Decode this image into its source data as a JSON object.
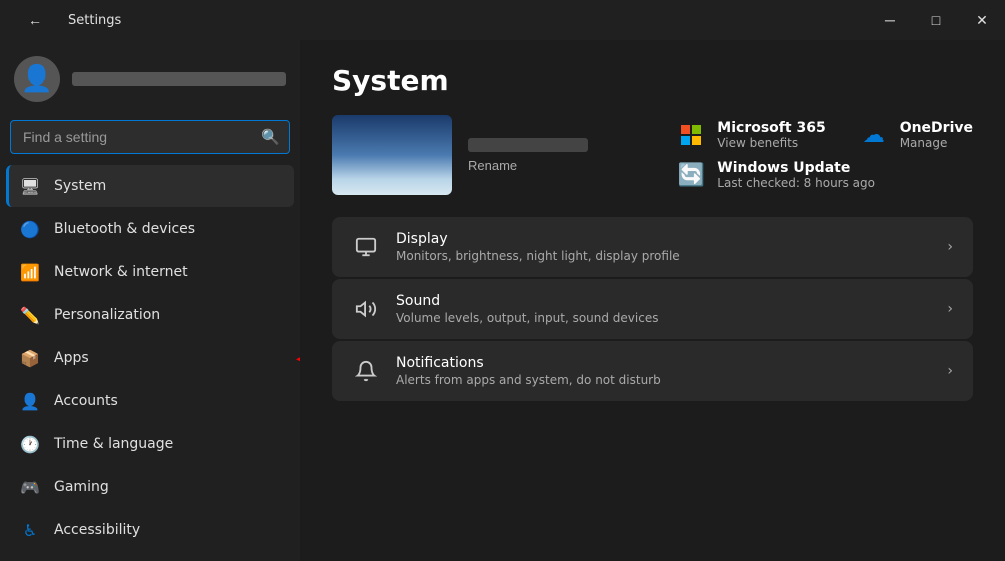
{
  "titlebar": {
    "back_icon": "←",
    "title": "Settings",
    "minimize_label": "─",
    "restore_label": "□",
    "close_label": "✕"
  },
  "sidebar": {
    "search_placeholder": "Find a setting",
    "search_icon": "🔍",
    "nav_items": [
      {
        "id": "system",
        "label": "System",
        "icon": "🖥",
        "active": true
      },
      {
        "id": "bluetooth",
        "label": "Bluetooth & devices",
        "icon": "🔵",
        "active": false
      },
      {
        "id": "network",
        "label": "Network & internet",
        "icon": "📶",
        "active": false
      },
      {
        "id": "personalization",
        "label": "Personalization",
        "icon": "✏️",
        "active": false
      },
      {
        "id": "apps",
        "label": "Apps",
        "icon": "📦",
        "active": false
      },
      {
        "id": "accounts",
        "label": "Accounts",
        "icon": "👤",
        "active": false
      },
      {
        "id": "time",
        "label": "Time & language",
        "icon": "🕐",
        "active": false
      },
      {
        "id": "gaming",
        "label": "Gaming",
        "icon": "🎮",
        "active": false
      },
      {
        "id": "accessibility",
        "label": "Accessibility",
        "icon": "♿",
        "active": false
      }
    ]
  },
  "content": {
    "page_title": "System",
    "pc_rename_label": "Rename",
    "info_cards": [
      {
        "id": "microsoft365",
        "icon": "⊞",
        "title": "Microsoft 365",
        "subtitle": "View benefits"
      },
      {
        "id": "onedrive",
        "icon": "☁",
        "title": "OneDrive",
        "subtitle": "Manage"
      },
      {
        "id": "windowsupdate",
        "icon": "🔄",
        "title": "Windows Update",
        "subtitle": "Last checked: 8 hours ago"
      }
    ],
    "settings_items": [
      {
        "id": "display",
        "icon": "🖥",
        "title": "Display",
        "description": "Monitors, brightness, night light, display profile"
      },
      {
        "id": "sound",
        "icon": "🔊",
        "title": "Sound",
        "description": "Volume levels, output, input, sound devices"
      },
      {
        "id": "notifications",
        "icon": "🔔",
        "title": "Notifications",
        "description": "Alerts from apps and system, do not disturb"
      }
    ]
  }
}
